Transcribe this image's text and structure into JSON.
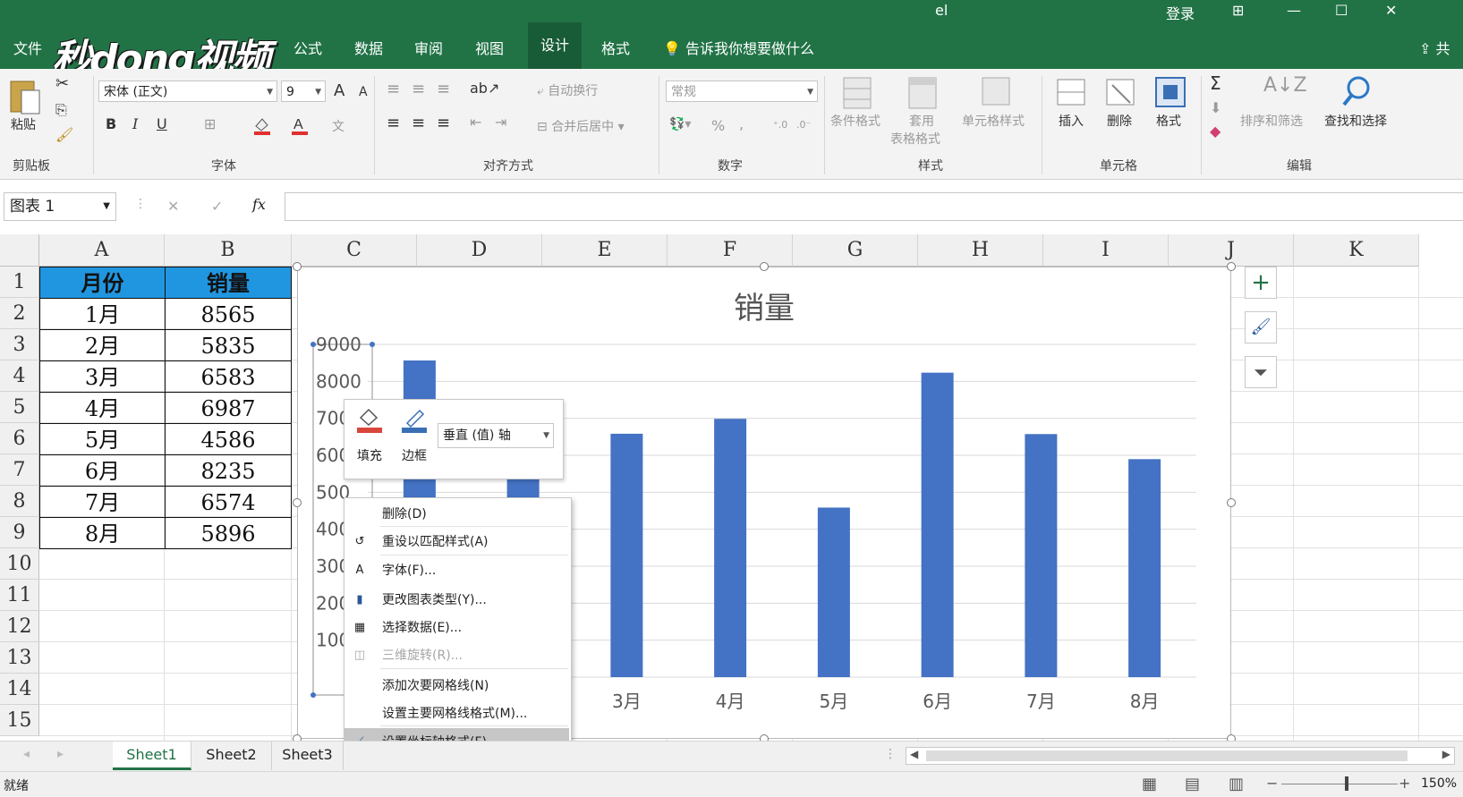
{
  "titlebar": {
    "app_fragment": "el",
    "login": "登录",
    "ribbon_display": "⊞",
    "minimize": "—",
    "maximize": "☐",
    "close": "✕"
  },
  "logo": {
    "text": "秒dong视频"
  },
  "tabs": [
    {
      "label": "文件"
    },
    {
      "label": "公式"
    },
    {
      "label": "数据"
    },
    {
      "label": "审阅"
    },
    {
      "label": "视图"
    },
    {
      "label": "设计"
    },
    {
      "label": "格式"
    }
  ],
  "tell_me": "告诉我你想要做什么",
  "share": "共",
  "ribbon": {
    "clipboard": {
      "paste": "粘贴",
      "group": "剪贴板"
    },
    "font": {
      "name": "宋体 (正文)",
      "size": "9",
      "bold": "B",
      "italic": "I",
      "underline": "U",
      "grow": "A",
      "shrink": "A",
      "group": "字体"
    },
    "align": {
      "wrap": "自动换行",
      "merge": "合并后居中",
      "group": "对齐方式"
    },
    "number": {
      "format": "常规",
      "percent": "%",
      "comma": ",",
      "group": "数字"
    },
    "styles": {
      "conditional": "条件格式",
      "table_line1": "套用",
      "table_line2": "表格格式",
      "cell_styles": "单元格样式",
      "group": "样式"
    },
    "cells": {
      "insert": "插入",
      "delete": "删除",
      "format": "格式",
      "group": "单元格"
    },
    "editing": {
      "sort": "排序和筛选",
      "find": "查找和选择",
      "group": "编辑"
    }
  },
  "formula_bar": {
    "name_box": "图表 1",
    "cancel": "✕",
    "enter": "✓",
    "fx": "fx",
    "value": ""
  },
  "columns": [
    "A",
    "B",
    "C",
    "D",
    "E",
    "F",
    "G",
    "H",
    "I",
    "J",
    "K"
  ],
  "rows": [
    "1",
    "2",
    "3",
    "4",
    "5",
    "6",
    "7",
    "8",
    "9",
    "10",
    "11",
    "12",
    "13",
    "14",
    "15"
  ],
  "table": {
    "headers": [
      "月份",
      "销量"
    ],
    "rows": [
      [
        "1月",
        "8565"
      ],
      [
        "2月",
        "5835"
      ],
      [
        "3月",
        "6583"
      ],
      [
        "4月",
        "6987"
      ],
      [
        "5月",
        "4586"
      ],
      [
        "6月",
        "8235"
      ],
      [
        "7月",
        "6574"
      ],
      [
        "8月",
        "5896"
      ]
    ]
  },
  "chart_data": {
    "type": "bar",
    "title": "销量",
    "categories": [
      "1月",
      "2月",
      "3月",
      "4月",
      "5月",
      "6月",
      "7月",
      "8月"
    ],
    "values": [
      8565,
      5835,
      6583,
      6987,
      4586,
      8235,
      6574,
      5896
    ],
    "ylim": [
      0,
      9000
    ],
    "visible_x_labels": [
      "3月",
      "4月",
      "5月",
      "6月",
      "7月",
      "8月"
    ],
    "y_tick_labels": [
      "9000",
      "8000",
      "700",
      "600",
      "500",
      "400",
      "300",
      "200",
      "100"
    ],
    "grid": true,
    "bar_color": "#4472c4"
  },
  "mini_toolbar": {
    "fill": "填充",
    "border": "边框",
    "element": "垂直 (值) 轴"
  },
  "context_menu": [
    {
      "label": "删除(D)",
      "icon": "none"
    },
    {
      "label": "重设以匹配样式(A)",
      "icon": "reset-style-icon"
    },
    {
      "label": "字体(F)...",
      "icon": "font-icon"
    },
    {
      "label": "更改图表类型(Y)...",
      "icon": "chart-type-icon"
    },
    {
      "label": "选择数据(E)...",
      "icon": "select-data-icon"
    },
    {
      "label": "三维旋转(R)...",
      "icon": "3d-rotation-icon",
      "disabled": true
    },
    {
      "label": "添加次要网格线(N)",
      "icon": "none"
    },
    {
      "label": "设置主要网格线格式(M)...",
      "icon": "none"
    },
    {
      "label": "设置坐标轴格式(F)...",
      "icon": "format-axis-icon",
      "highlighted": true
    }
  ],
  "sheets": [
    "Sheet1",
    "Sheet2",
    "Sheet3"
  ],
  "status": {
    "ready": "就绪",
    "zoom": "150%"
  }
}
